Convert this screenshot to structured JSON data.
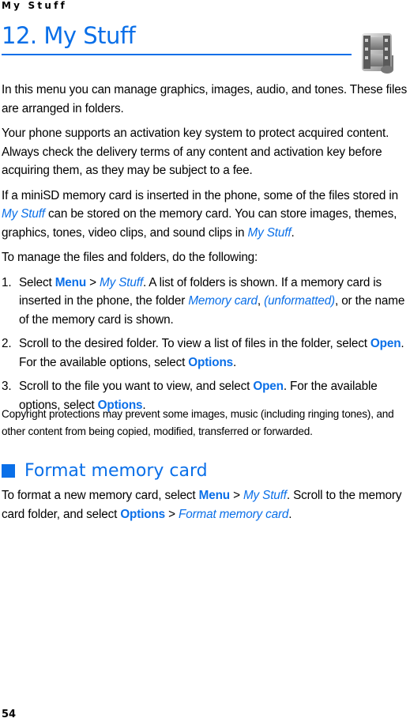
{
  "running_head": "My Stuff",
  "chapter": {
    "title": "12. My Stuff",
    "icon": "film-media-icon"
  },
  "paragraphs": {
    "p1": "In this menu you can manage graphics, images, audio, and tones. These files are arranged in folders.",
    "p2": "Your phone supports an activation key system to protect acquired content. Always check the delivery terms of any content and activation key before acquiring them, as they may be subject to a fee.",
    "p3": {
      "a": "If a miniSD memory card is inserted in the phone, some of the files stored in ",
      "link1": "My Stuff",
      "b": " can be stored on the memory card. You can store images, themes, graphics, tones, video clips, and sound clips in ",
      "link2": "My Stuff",
      "c": "."
    },
    "p4": "To manage the files and folders, do the following:"
  },
  "steps": [
    {
      "num": "1.",
      "a": "Select ",
      "menu": "Menu",
      "sep": " > ",
      "mystuff": "My Stuff",
      "b": ". A list of folders is shown. If a memory card is inserted in the phone, the folder ",
      "memcard": "Memory card",
      "c": ", ",
      "unformatted": "(unformatted)",
      "d": ", or the name of the memory card is shown."
    },
    {
      "num": "2.",
      "a": "Scroll to the desired folder. To view a list of files in the folder, select ",
      "open": "Open",
      "b": ". For the available options, select ",
      "options": "Options",
      "c": "."
    },
    {
      "num": "3.",
      "a": "Scroll to the file you want to view, and select ",
      "open": "Open",
      "b": ". For the available options, select ",
      "options": "Options",
      "c": "."
    }
  ],
  "copyright_note": "Copyright protections may prevent some images, music (including ringing tones), and other content from being copied, modified, transferred or forwarded.",
  "section": {
    "title": "Format memory card",
    "text": {
      "a": "To format a new memory card, select ",
      "menu": "Menu",
      "sep1": " > ",
      "mystuff": "My Stuff",
      "b": ". Scroll to the memory card folder, and select ",
      "options": "Options",
      "sep2": " > ",
      "format": "Format memory card",
      "c": "."
    }
  },
  "page_number": "54",
  "colors": {
    "accent": "#0a6fe8"
  }
}
